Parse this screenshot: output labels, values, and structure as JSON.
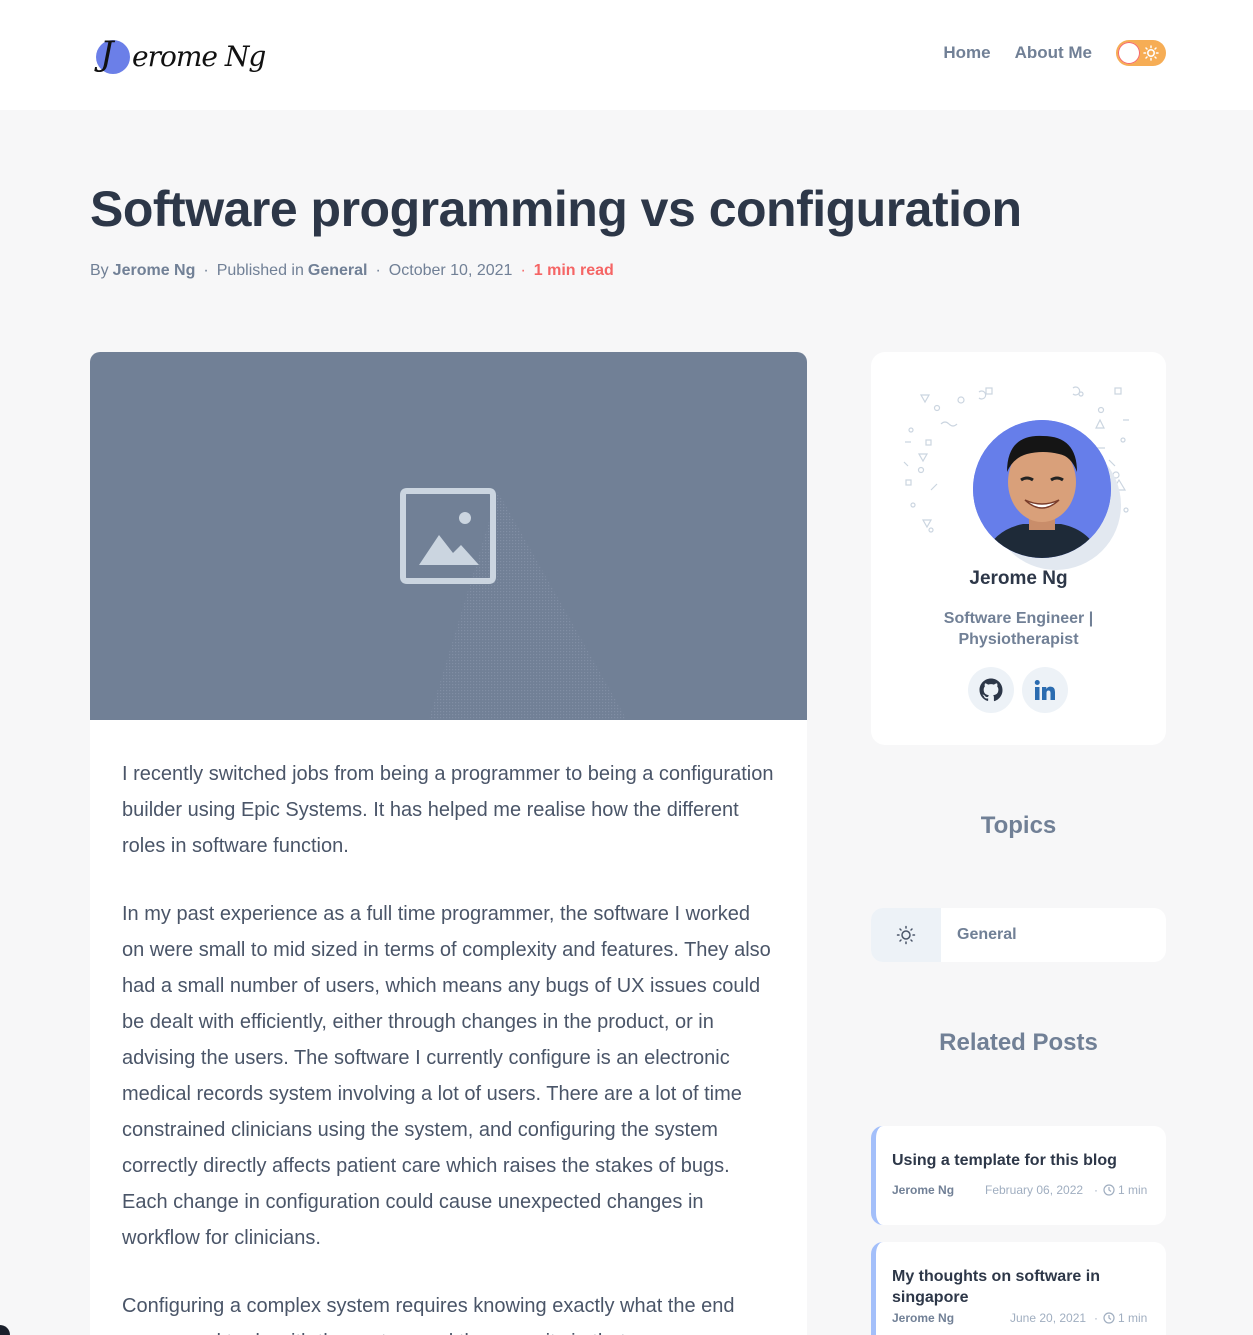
{
  "header": {
    "logo_initial": "J",
    "logo_rest": "erome Ng",
    "nav": [
      {
        "label": "Home"
      },
      {
        "label": "About Me"
      }
    ]
  },
  "post": {
    "title": "Software programming vs configuration",
    "by_label": "By",
    "author": "Jerome Ng",
    "published_label": "Published in",
    "category": "General",
    "date": "October 10, 2021",
    "read_time": "1 min read",
    "paragraphs": [
      "I recently switched jobs from being a programmer to being a configuration builder using Epic Systems. It has helped me realise how the different roles in software function.",
      "In my past experience as a full time programmer, the software I worked on were small to mid sized in terms of complexity and features. They also had a small number of users, which means any bugs of UX issues could be dealt with efficiently, either through changes in the product, or in advising the users. The software I currently configure is an electronic medical records system involving a lot of users. There are a lot of time constrained clinicians using the system, and configuring the system correctly directly affects patient care which raises the stakes of bugs. Each change in configuration could cause unexpected changes in workflow for clinicians.",
      "Configuring a complex system requires knowing exactly what the end users need to do with the system and the capacity in that"
    ]
  },
  "sidebar": {
    "profile": {
      "name": "Jerome Ng",
      "role": "Software Engineer | Physiotherapist"
    },
    "topics_title": "Topics",
    "topics": [
      {
        "label": "General"
      }
    ],
    "related_title": "Related Posts",
    "related": [
      {
        "title": "Using a template for this blog",
        "author": "Jerome Ng",
        "date": "February 06, 2022",
        "minutes": "1 min"
      },
      {
        "title": "My thoughts on software in singapore",
        "author": "Jerome Ng",
        "date": "June 20, 2021",
        "minutes": "1 min"
      }
    ]
  },
  "colors": {
    "accent": "#667eea",
    "read_time": "#f56565",
    "toggle": "#f6ad55",
    "cover": "#718096"
  }
}
